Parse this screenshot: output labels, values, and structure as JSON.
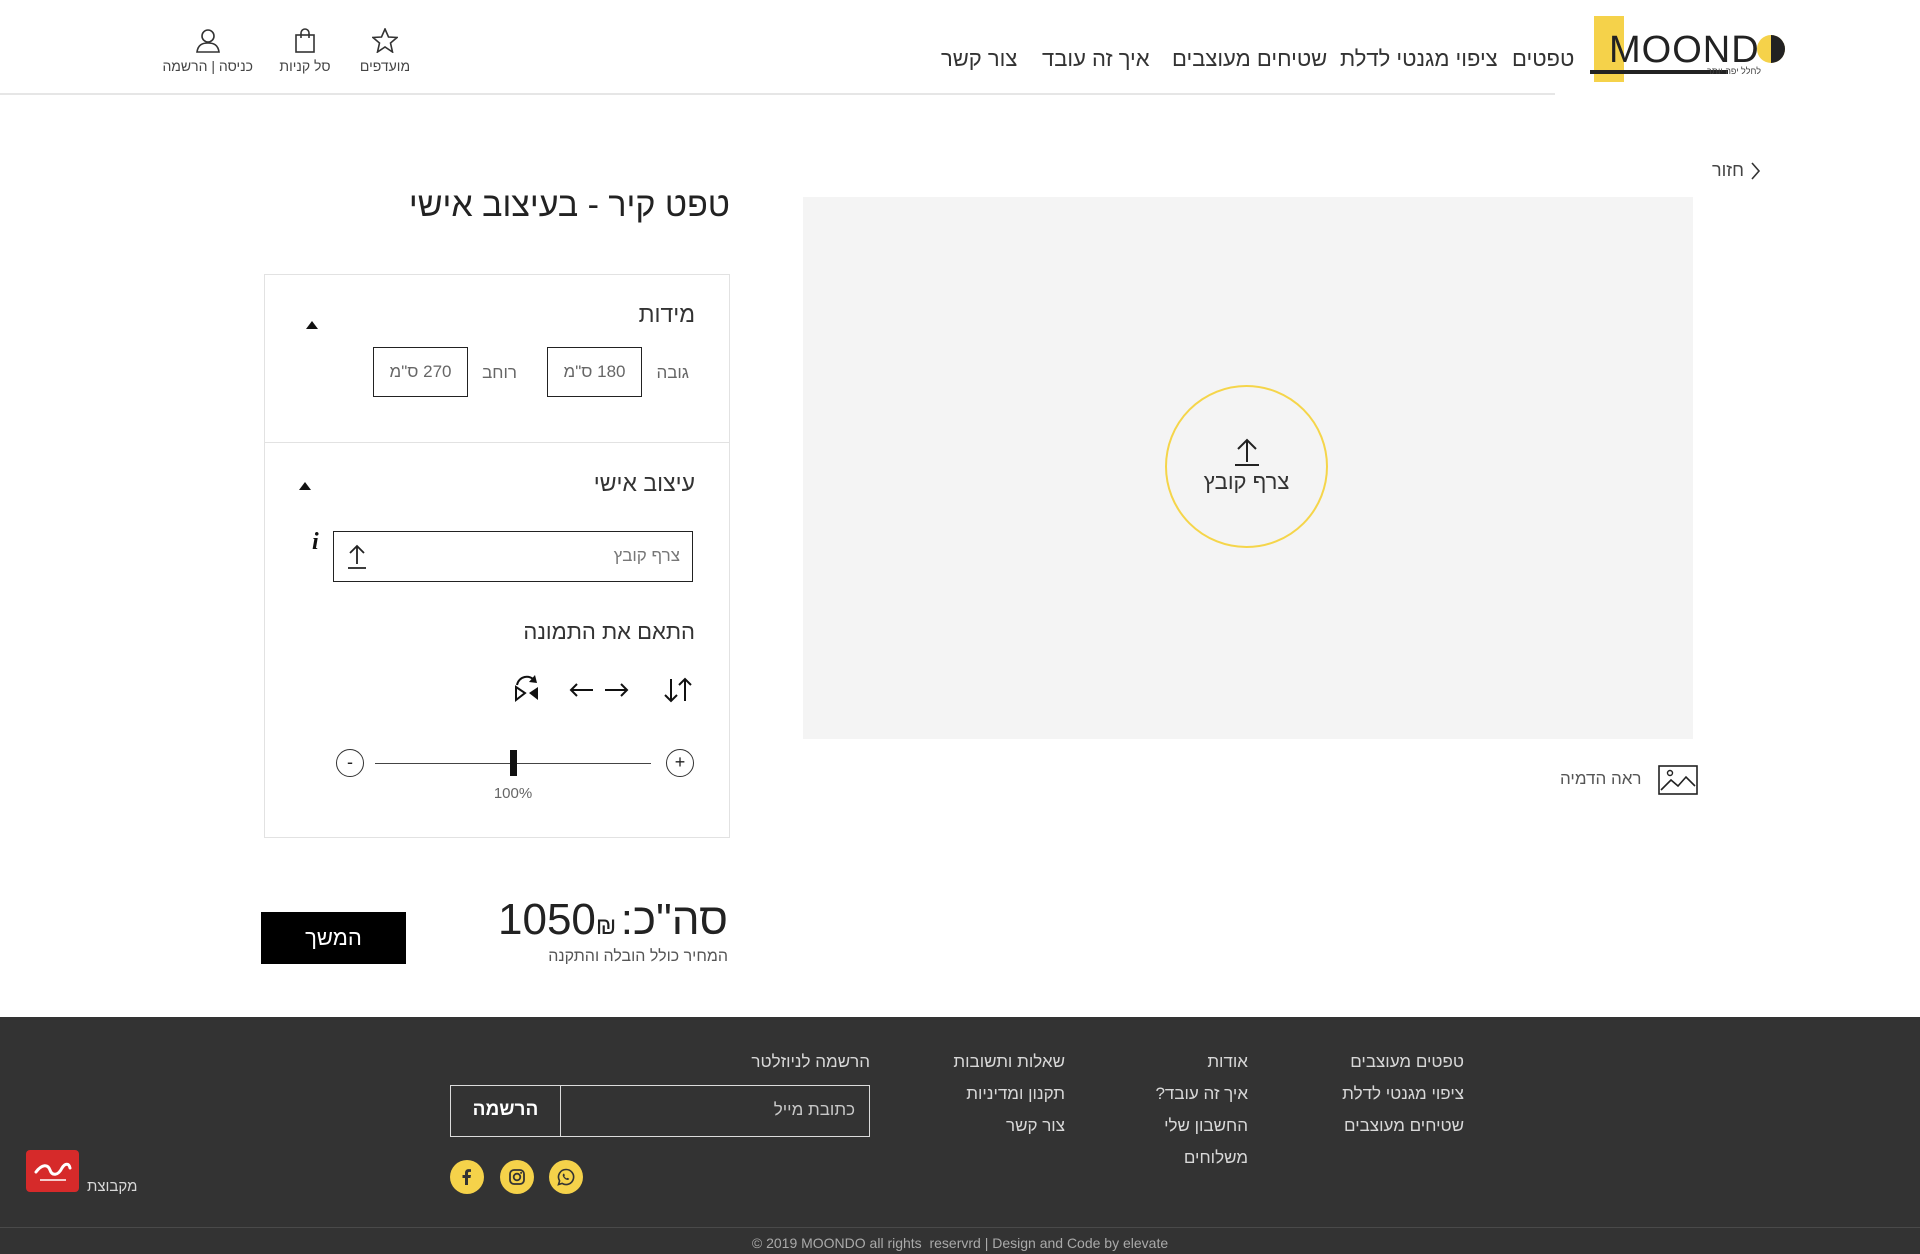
{
  "header": {
    "logo_text": "MOONDO",
    "logo_tagline": "לחלל יפה יותר",
    "nav": [
      "טפטים",
      "ציפוי מגנטי לדלת",
      "שטיחים מעוצבים",
      "איך זה עובד",
      "צור קשר"
    ],
    "favorites_label": "מועדפים",
    "cart_label": "סל קניות",
    "login_label": "כניסה | הרשמה"
  },
  "product": {
    "back_label": "חזור",
    "title": "טפט קיר - בעיצוב אישי",
    "upload_circle_label": "צרף קובץ",
    "preview_label": "ראה הדמיה"
  },
  "options": {
    "dimensions_title": "מידות",
    "height_label": "גובה",
    "height_value": "180 ס\"מ",
    "width_label": "רוחב",
    "width_value": "270 ס\"מ",
    "design_title": "עיצוב אישי",
    "file_placeholder": "צרף קובץ",
    "info_icon": "i",
    "adjust_title": "התאם את התמונה",
    "zoom_minus": "-",
    "zoom_plus": "+",
    "zoom_value": "100%",
    "zoom_fraction": 0.5
  },
  "price": {
    "total_label": "סה\"כ:",
    "amount": "1050",
    "currency": "₪",
    "note": "המחיר כולל הובלה והתקנה",
    "continue_label": "המשך"
  },
  "footer": {
    "col1": [
      "טפטים מעוצבים",
      "ציפוי מגנטי לדלת",
      "שטיחים מעוצבים"
    ],
    "col2": [
      "אודות",
      "איך זה עובד?",
      "החשבון שלי",
      "משלוחים"
    ],
    "col3": [
      "שאלות ותשובות",
      "תקנון ומדיניות",
      "צור קשר"
    ],
    "newsletter_title": "הרשמה לניוזלטר",
    "email_placeholder": "כתובת מייל",
    "subscribe_label": "הרשמה",
    "group_label": "מקבוצת",
    "copyright": "© 2019 MOONDO all rights  reservrd | Design and Code by elevate"
  },
  "colors": {
    "accent": "#f5d24a",
    "footer_bg": "#333333",
    "preview_bg": "#f4f4f4"
  }
}
